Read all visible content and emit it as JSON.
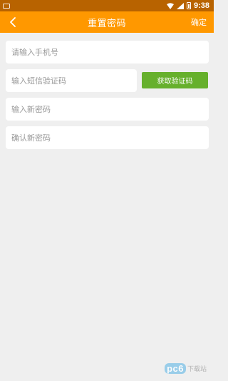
{
  "status_bar": {
    "time": "9:38",
    "icons": [
      "app-notification-icon",
      "wifi-icon",
      "signal-icon",
      "battery-icon"
    ]
  },
  "header": {
    "title": "重置密码",
    "back_icon": "chevron-left-icon",
    "confirm_label": "确定",
    "background": "#ff9800"
  },
  "form": {
    "phone_placeholder": "请输入手机号",
    "sms_code_placeholder": "输入短信验证码",
    "get_code_label": "获取验证码",
    "new_password_placeholder": "输入新密码",
    "confirm_password_placeholder": "确认新密码",
    "get_code_color": "#66b02c"
  },
  "watermark": {
    "logo_text": "pc6",
    "site_text": "下载站"
  }
}
